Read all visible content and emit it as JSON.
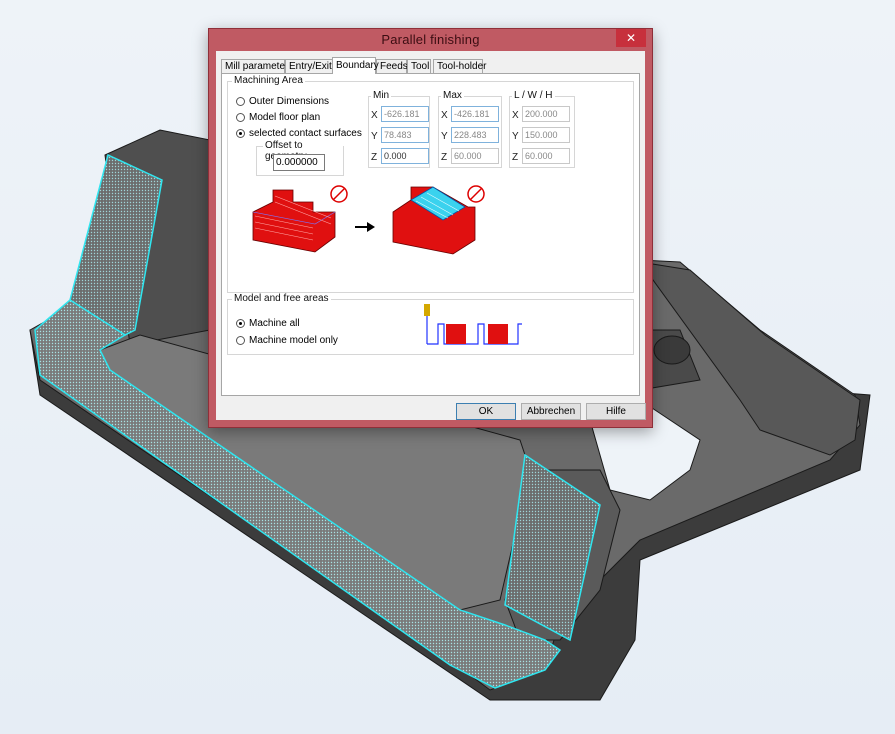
{
  "dialog": {
    "title": "Parallel finishing",
    "close_icon": "close-icon",
    "tabs": [
      {
        "label": "Mill parameters",
        "active": false
      },
      {
        "label": "Entry/Exit",
        "active": false
      },
      {
        "label": "Boundary",
        "active": true
      },
      {
        "label": "Feeds",
        "active": false
      },
      {
        "label": "Tool",
        "active": false
      },
      {
        "label": "Tool-holder",
        "active": false
      }
    ],
    "machining_area": {
      "label": "Machining Area",
      "options": [
        {
          "label": "Outer Dimensions",
          "selected": false
        },
        {
          "label": "Model floor plan",
          "selected": false
        },
        {
          "label": "selected contact surfaces",
          "selected": true
        }
      ],
      "offset": {
        "label": "Offset to geometry",
        "value": "0.000000"
      },
      "min": {
        "label": "Min",
        "x": "-626.181",
        "y": "78.483",
        "z": "0.000"
      },
      "max": {
        "label": "Max",
        "x": "-426.181",
        "y": "228.483",
        "z": "60.000"
      },
      "lwh": {
        "label": "L / W / H",
        "x": "200.000",
        "y": "150.000",
        "z": "60.000"
      },
      "axis_labels": {
        "x": "X",
        "y": "Y",
        "z": "Z"
      }
    },
    "model_free": {
      "label": "Model and free areas",
      "options": [
        {
          "label": "Machine all",
          "selected": true
        },
        {
          "label": "Machine model only",
          "selected": false
        }
      ]
    },
    "buttons": {
      "ok": "OK",
      "cancel": "Abbrechen",
      "help": "Hilfe"
    }
  },
  "colors": {
    "titlebar": "#c05a63",
    "close": "#c7303c",
    "model_grey": "#5a5a5a",
    "selection_cyan": "#2fe6f0",
    "block_red": "#e01010"
  }
}
